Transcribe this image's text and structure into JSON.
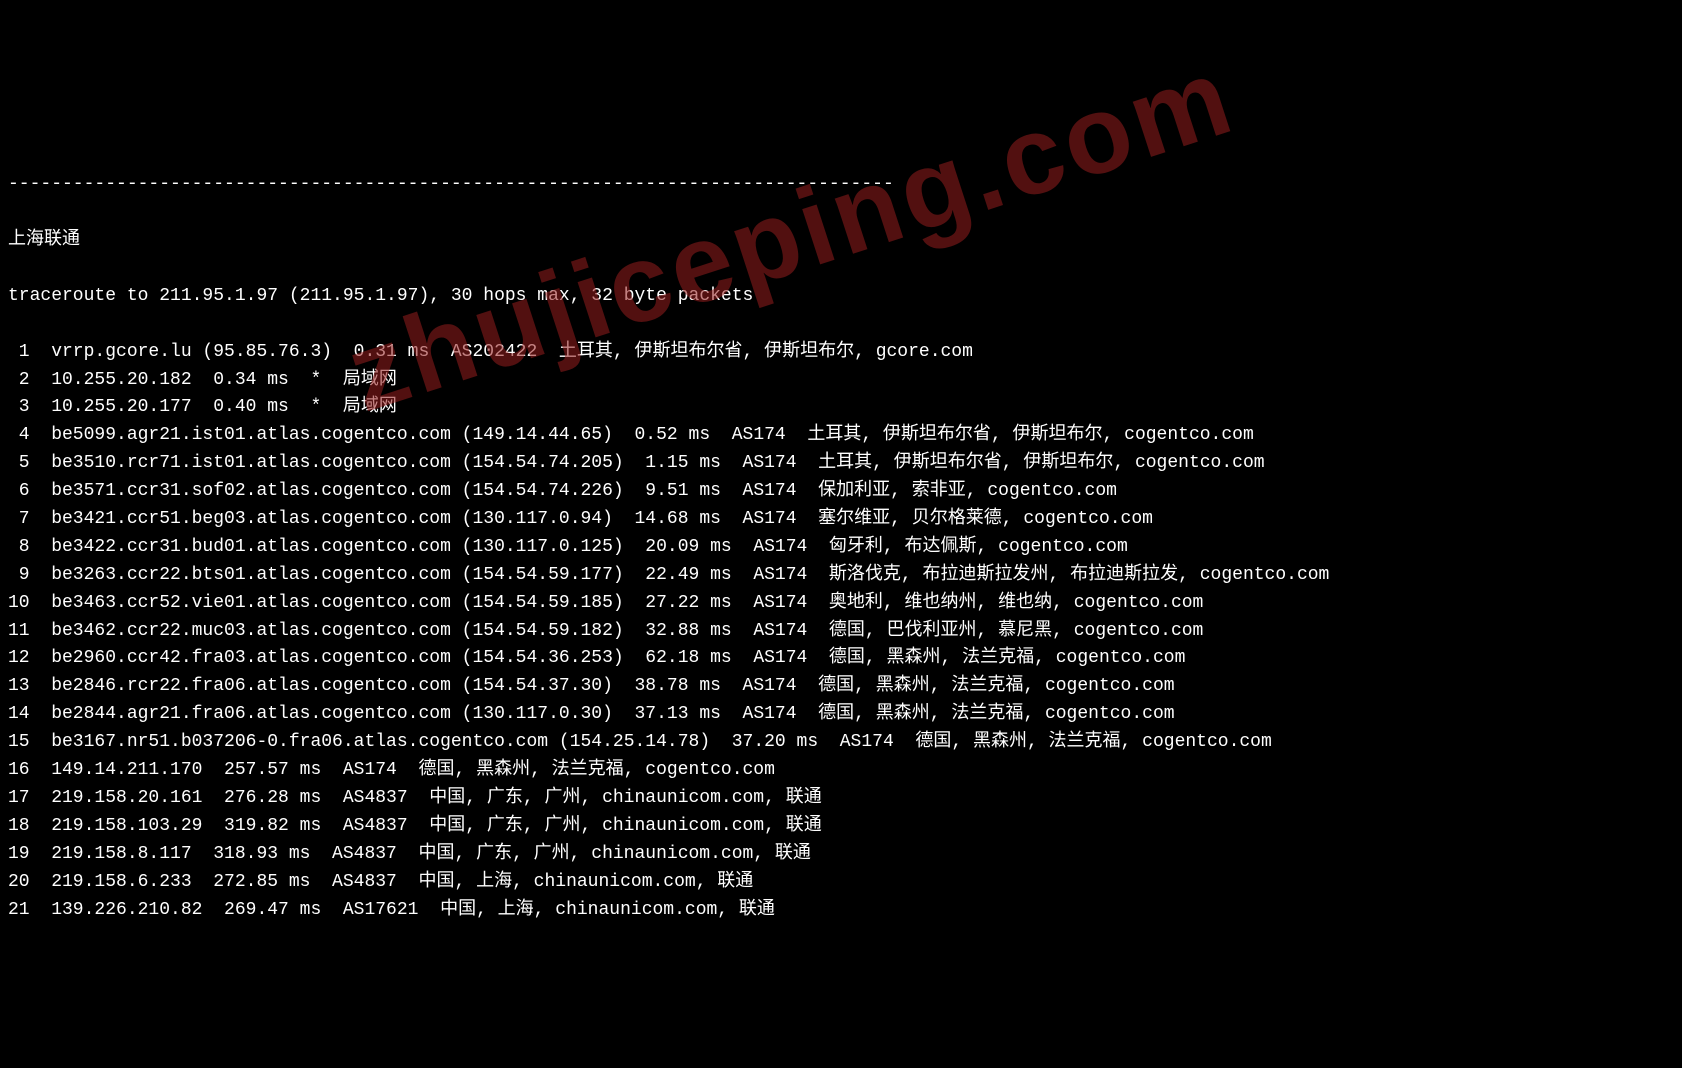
{
  "watermark": "zhujiceping.com",
  "separator": "----------------------------------------------------------------------------------",
  "title": "上海联通",
  "traceroute_header": "traceroute to 211.95.1.97 (211.95.1.97), 30 hops max, 32 byte packets",
  "hops": [
    {
      "n": "1",
      "line": " 1  vrrp.gcore.lu (95.85.76.3)  0.31 ms  AS202422  土耳其, 伊斯坦布尔省, 伊斯坦布尔, gcore.com"
    },
    {
      "n": "2",
      "line": " 2  10.255.20.182  0.34 ms  *  局域网"
    },
    {
      "n": "3",
      "line": " 3  10.255.20.177  0.40 ms  *  局域网"
    },
    {
      "n": "4",
      "line": " 4  be5099.agr21.ist01.atlas.cogentco.com (149.14.44.65)  0.52 ms  AS174  土耳其, 伊斯坦布尔省, 伊斯坦布尔, cogentco.com"
    },
    {
      "n": "5",
      "line": " 5  be3510.rcr71.ist01.atlas.cogentco.com (154.54.74.205)  1.15 ms  AS174  土耳其, 伊斯坦布尔省, 伊斯坦布尔, cogentco.com"
    },
    {
      "n": "6",
      "line": " 6  be3571.ccr31.sof02.atlas.cogentco.com (154.54.74.226)  9.51 ms  AS174  保加利亚, 索非亚, cogentco.com"
    },
    {
      "n": "7",
      "line": " 7  be3421.ccr51.beg03.atlas.cogentco.com (130.117.0.94)  14.68 ms  AS174  塞尔维亚, 贝尔格莱德, cogentco.com"
    },
    {
      "n": "8",
      "line": " 8  be3422.ccr31.bud01.atlas.cogentco.com (130.117.0.125)  20.09 ms  AS174  匈牙利, 布达佩斯, cogentco.com"
    },
    {
      "n": "9",
      "line": " 9  be3263.ccr22.bts01.atlas.cogentco.com (154.54.59.177)  22.49 ms  AS174  斯洛伐克, 布拉迪斯拉发州, 布拉迪斯拉发, cogentco.com"
    },
    {
      "n": "10",
      "line": "10  be3463.ccr52.vie01.atlas.cogentco.com (154.54.59.185)  27.22 ms  AS174  奥地利, 维也纳州, 维也纳, cogentco.com"
    },
    {
      "n": "11",
      "line": "11  be3462.ccr22.muc03.atlas.cogentco.com (154.54.59.182)  32.88 ms  AS174  德国, 巴伐利亚州, 慕尼黑, cogentco.com"
    },
    {
      "n": "12",
      "line": "12  be2960.ccr42.fra03.atlas.cogentco.com (154.54.36.253)  62.18 ms  AS174  德国, 黑森州, 法兰克福, cogentco.com"
    },
    {
      "n": "13",
      "line": "13  be2846.rcr22.fra06.atlas.cogentco.com (154.54.37.30)  38.78 ms  AS174  德国, 黑森州, 法兰克福, cogentco.com"
    },
    {
      "n": "14",
      "line": "14  be2844.agr21.fra06.atlas.cogentco.com (130.117.0.30)  37.13 ms  AS174  德国, 黑森州, 法兰克福, cogentco.com"
    },
    {
      "n": "15",
      "line": "15  be3167.nr51.b037206-0.fra06.atlas.cogentco.com (154.25.14.78)  37.20 ms  AS174  德国, 黑森州, 法兰克福, cogentco.com"
    },
    {
      "n": "16",
      "line": "16  149.14.211.170  257.57 ms  AS174  德国, 黑森州, 法兰克福, cogentco.com"
    },
    {
      "n": "17",
      "line": "17  219.158.20.161  276.28 ms  AS4837  中国, 广东, 广州, chinaunicom.com, 联通"
    },
    {
      "n": "18",
      "line": "18  219.158.103.29  319.82 ms  AS4837  中国, 广东, 广州, chinaunicom.com, 联通"
    },
    {
      "n": "19",
      "line": "19  219.158.8.117  318.93 ms  AS4837  中国, 广东, 广州, chinaunicom.com, 联通"
    },
    {
      "n": "20",
      "line": "20  219.158.6.233  272.85 ms  AS4837  中国, 上海, chinaunicom.com, 联通"
    },
    {
      "n": "21",
      "line": "21  139.226.210.82  269.47 ms  AS17621  中国, 上海, chinaunicom.com, 联通"
    }
  ]
}
